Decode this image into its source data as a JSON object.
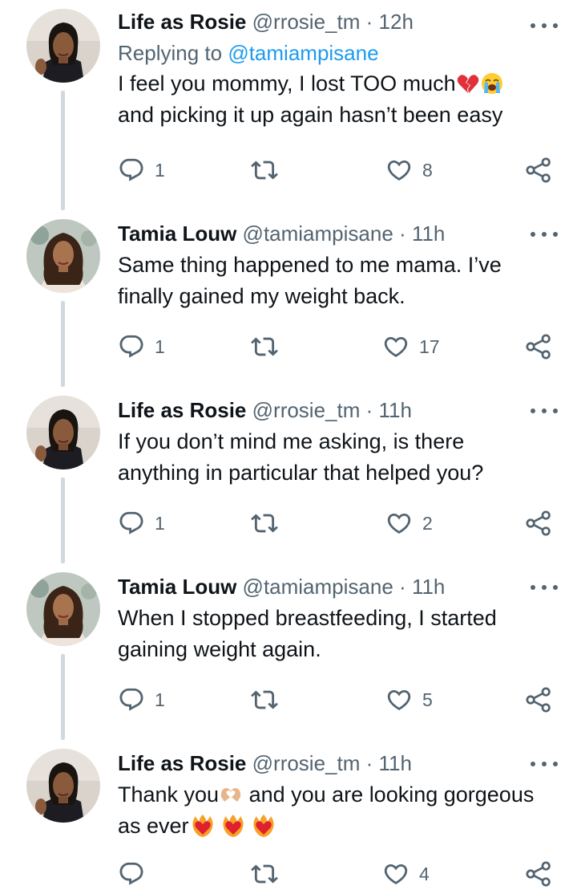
{
  "colors": {
    "text": "#0f1419",
    "muted": "#536471",
    "link": "#1d9bf0",
    "line": "#cfd9de"
  },
  "tweets": [
    {
      "name": "Life as Rosie",
      "handle": "@rrosie_tm",
      "dot": "·",
      "time": "12h",
      "reply_prefix": "Replying to",
      "reply_mention": "@tamiampisane",
      "lines": [
        "I feel you mommy, I lost TOO much",
        "and picking it up again hasn’t been easy"
      ],
      "emojis": [
        "broken-heart-emoji",
        "loudly-crying-face-emoji"
      ],
      "reply_count": "1",
      "retweet_count": "",
      "like_count": "8"
    },
    {
      "name": "Tamia Louw",
      "handle": "@tamiampisane",
      "dot": "·",
      "time": "11h",
      "lines": [
        "Same thing happened to me mama. I’ve",
        "finally gained my weight back."
      ],
      "reply_count": "1",
      "retweet_count": "",
      "like_count": "17"
    },
    {
      "name": "Life as Rosie",
      "handle": "@rrosie_tm",
      "dot": "·",
      "time": "11h",
      "lines": [
        "If you don’t mind me asking, is there",
        "anything in particular that helped you?"
      ],
      "reply_count": "1",
      "retweet_count": "",
      "like_count": "2"
    },
    {
      "name": "Tamia Louw",
      "handle": "@tamiampisane",
      "dot": "·",
      "time": "11h",
      "lines": [
        "When I stopped breastfeeding, I started",
        "gaining weight again."
      ],
      "reply_count": "1",
      "retweet_count": "",
      "like_count": "5"
    },
    {
      "name": "Life as Rosie",
      "handle": "@rrosie_tm",
      "dot": "·",
      "time": "11h",
      "line1_a": "Thank you",
      "line1_b": " and you are looking gorgeous",
      "line2": "as ever",
      "emojis": [
        "heart-hands-emoji",
        "heart-on-fire-emoji",
        "heart-on-fire-emoji",
        "heart-on-fire-emoji"
      ],
      "reply_count": "",
      "retweet_count": "",
      "like_count": "4"
    }
  ]
}
